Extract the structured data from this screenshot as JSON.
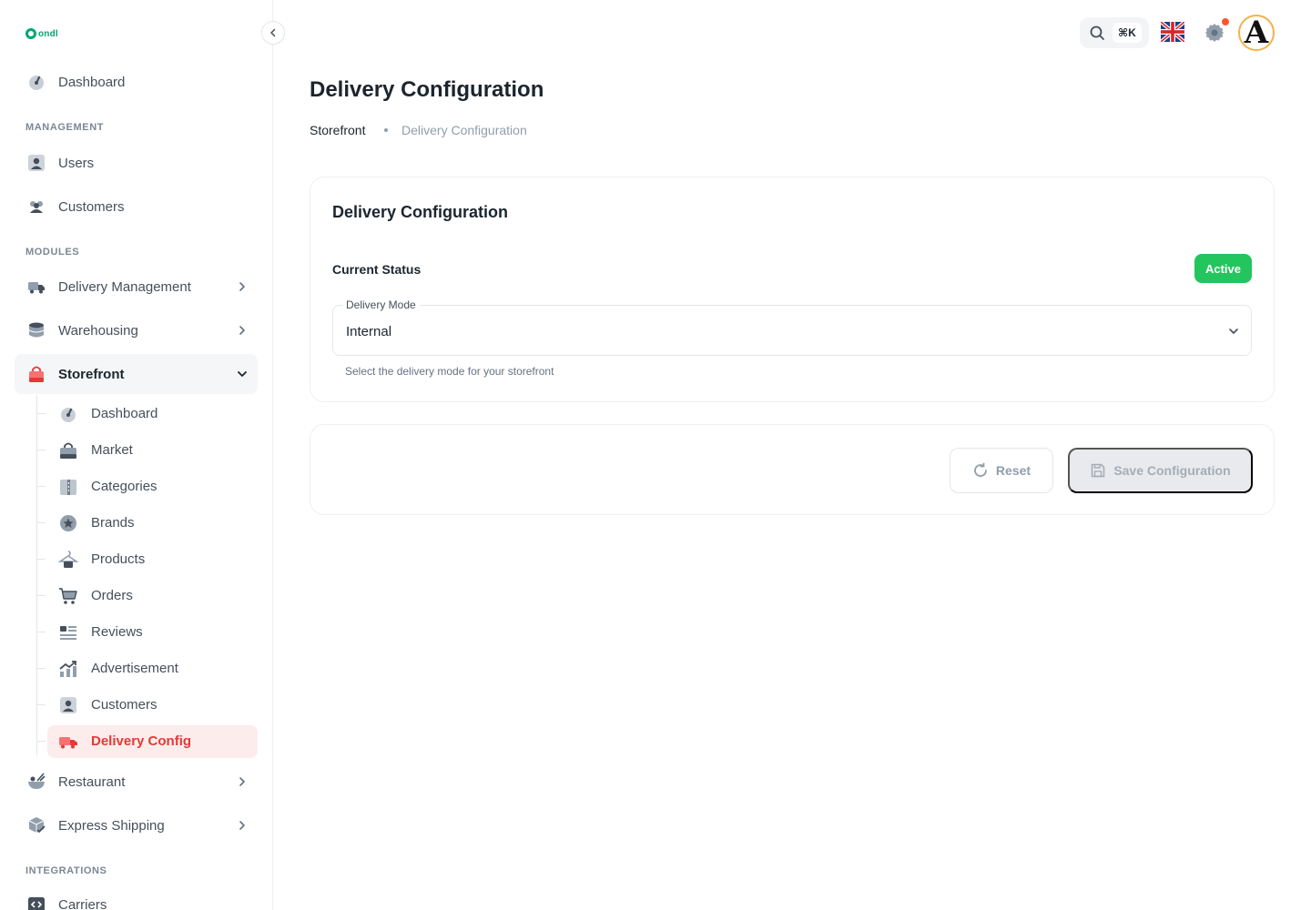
{
  "app": {
    "logo_text": "ondl"
  },
  "sidebar": {
    "top_item": {
      "label": "Dashboard",
      "icon": "dashboard-gauge-icon"
    },
    "sections": {
      "management": "MANAGEMENT",
      "modules": "MODULES",
      "integrations": "INTEGRATIONS"
    },
    "management_items": [
      {
        "label": "Users",
        "icon": "user-icon"
      },
      {
        "label": "Customers",
        "icon": "customers-group-icon"
      }
    ],
    "module_items": [
      {
        "label": "Delivery Management",
        "icon": "truck-icon",
        "expandable": true
      },
      {
        "label": "Warehousing",
        "icon": "database-icon",
        "expandable": true
      },
      {
        "label": "Storefront",
        "icon": "shopping-bag-icon",
        "expanded": true
      },
      {
        "label": "Restaurant",
        "icon": "food-bowl-icon",
        "expandable": true
      },
      {
        "label": "Express Shipping",
        "icon": "package-icon",
        "expandable": true
      }
    ],
    "storefront_sub_items": [
      {
        "label": "Dashboard",
        "icon": "dashboard-gauge-icon"
      },
      {
        "label": "Market",
        "icon": "bag-icon"
      },
      {
        "label": "Categories",
        "icon": "folder-icon"
      },
      {
        "label": "Brands",
        "icon": "star-icon"
      },
      {
        "label": "Products",
        "icon": "hanger-icon"
      },
      {
        "label": "Orders",
        "icon": "cart-icon"
      },
      {
        "label": "Reviews",
        "icon": "list-icon"
      },
      {
        "label": "Advertisement",
        "icon": "chart-up-icon"
      },
      {
        "label": "Customers",
        "icon": "user-icon"
      },
      {
        "label": "Delivery Config",
        "icon": "truck-icon",
        "active": true
      }
    ],
    "integration_items": [
      {
        "label": "Carriers",
        "icon": "code-box-icon"
      }
    ]
  },
  "topbar": {
    "search_shortcut": "⌘K",
    "language": "English (UK)",
    "notification_dot_color": "#ff5630",
    "avatar_letter": "A"
  },
  "page": {
    "title": "Delivery Configuration",
    "breadcrumb": [
      "Storefront",
      "Delivery Configuration"
    ]
  },
  "config_card": {
    "title": "Delivery Configuration",
    "status_label": "Current Status",
    "status_value": "Active",
    "status_color": "#22c55e",
    "delivery_mode_label": "Delivery Mode",
    "delivery_mode_value": "Internal",
    "helper_text": "Select the delivery mode for your storefront"
  },
  "actions": {
    "reset_label": "Reset",
    "save_label": "Save Configuration"
  },
  "colors": {
    "accent": "#e53935",
    "active_bg": "#fdecec"
  }
}
